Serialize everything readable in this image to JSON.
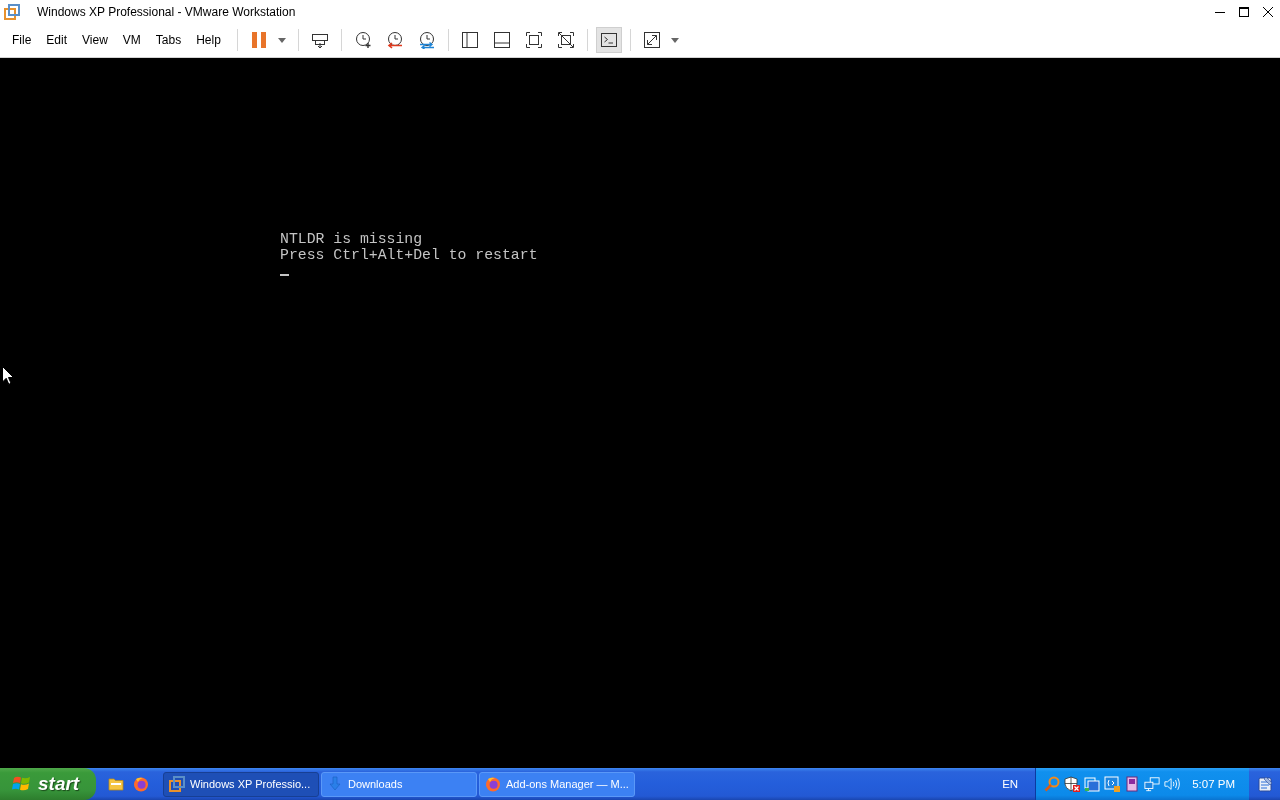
{
  "window": {
    "title": "Windows XP Professional - VMware Workstation"
  },
  "menu": [
    "File",
    "Edit",
    "View",
    "VM",
    "Tabs",
    "Help"
  ],
  "toolbar": [
    [
      {
        "kind": "pause",
        "dropdown": true,
        "selected": false
      }
    ],
    [
      {
        "kind": "send-keys",
        "dropdown": false,
        "selected": false
      }
    ],
    [
      {
        "kind": "snapshot",
        "dropdown": false,
        "selected": false
      },
      {
        "kind": "revert",
        "dropdown": false,
        "selected": false
      },
      {
        "kind": "snapshot-manager",
        "dropdown": false,
        "selected": false
      }
    ],
    [
      {
        "kind": "library",
        "dropdown": false,
        "selected": false
      },
      {
        "kind": "thumbnails",
        "dropdown": false,
        "selected": false
      },
      {
        "kind": "fit-guest",
        "dropdown": false,
        "selected": false
      },
      {
        "kind": "autofit",
        "dropdown": false,
        "selected": false
      }
    ],
    [
      {
        "kind": "console",
        "dropdown": false,
        "selected": true
      }
    ],
    [
      {
        "kind": "fullscreen",
        "dropdown": true,
        "selected": false
      }
    ]
  ],
  "console": {
    "lines": [
      "NTLDR is missing",
      "Press Ctrl+Alt+Del to restart"
    ],
    "cursor": true
  },
  "taskbar": {
    "start": "start",
    "quick_launch": [
      {
        "kind": "folder"
      },
      {
        "kind": "firefox"
      }
    ],
    "tasks": [
      {
        "kind": "vmware",
        "label": "Windows XP Professio...",
        "selected": true
      },
      {
        "kind": "download",
        "label": "Downloads",
        "selected": false
      },
      {
        "kind": "firefox",
        "label": "Add-ons Manager — M...",
        "selected": false
      }
    ],
    "language": "EN",
    "tray": [
      {
        "kind": "search"
      },
      {
        "kind": "security-alert"
      },
      {
        "kind": "windows"
      },
      {
        "kind": "display"
      },
      {
        "kind": "device"
      },
      {
        "kind": "network"
      },
      {
        "kind": "volume"
      }
    ],
    "clock": "5:07 PM"
  }
}
